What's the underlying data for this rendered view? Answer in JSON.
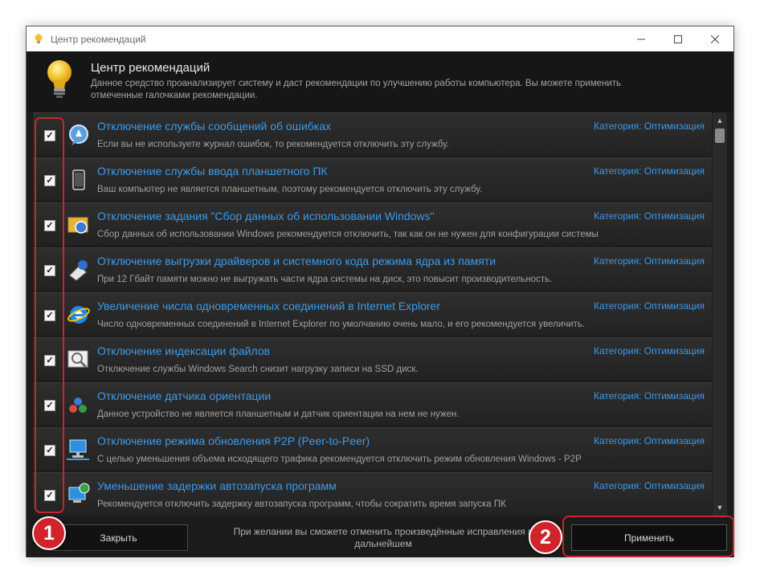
{
  "window": {
    "title": "Центр рекомендаций",
    "controls": [
      "minimize-icon",
      "maximize-icon",
      "close-icon"
    ]
  },
  "header": {
    "title": "Центр рекомендаций",
    "description": "Данное средство проанализирует систему и даст рекомендации по улучшению работы компьютера. Вы можете применить отмеченные галочками рекомендации."
  },
  "items": [
    {
      "title": "Отключение службы сообщений об ошибках",
      "category": "Категория: Оптимизация",
      "description": "Если вы не используете журнал ошибок, то рекомендуется отключить эту службу.",
      "checked": true,
      "icon": "error-report-icon"
    },
    {
      "title": "Отключение службы ввода планшетного ПК",
      "category": "Категория: Оптимизация",
      "description": "Ваш компьютер не является планшетным, поэтому рекомендуется отключить эту службу.",
      "checked": true,
      "icon": "tablet-icon"
    },
    {
      "title": "Отключение задания \"Сбор данных об использовании Windows\"",
      "category": "Категория: Оптимизация",
      "description": "Сбор данных об использовании Windows рекомендуется отключить, так как он не нужен для конфигурации системы",
      "checked": true,
      "icon": "data-collection-icon"
    },
    {
      "title": "Отключение выгрузки драйверов и системного кода режима ядра из памяти",
      "category": "Категория: Оптимизация",
      "description": "При 12 Гбайт памяти можно не выгружать части ядра системы на диск, это повысит производительность.",
      "checked": true,
      "icon": "memory-icon"
    },
    {
      "title": "Увеличение числа одновременных соединений в Internet Explorer",
      "category": "Категория: Оптимизация",
      "description": "Число одновременных соединений в Internet Explorer по умолчанию очень мало, и его рекомендуется увеличить.",
      "checked": true,
      "icon": "internet-explorer-icon"
    },
    {
      "title": "Отключение индексации файлов",
      "category": "Категория: Оптимизация",
      "description": "Отключение службы Windows Search снизит нагрузку записи на SSD диск.",
      "checked": true,
      "icon": "search-indexing-icon"
    },
    {
      "title": "Отключение датчика ориентации",
      "category": "Категория: Оптимизация",
      "description": "Данное устройство не является планшетным и датчик ориентации на нем не нужен.",
      "checked": true,
      "icon": "orientation-sensor-icon"
    },
    {
      "title": "Отключение режима обновления P2P (Peer-to-Peer)",
      "category": "Категория: Оптимизация",
      "description": "С целью уменьшения объема исходящего трафика рекомендуется отключить режим обновления Windows - P2P",
      "checked": true,
      "icon": "network-computer-icon"
    },
    {
      "title": "Уменьшение задержки автозапуска программ",
      "category": "Категория: Оптимизация",
      "description": "Рекомендуется отключить задержку автозапуска программ, чтобы сократить время запуска ПК",
      "checked": true,
      "icon": "autostart-icon"
    }
  ],
  "footer": {
    "close_label": "Закрыть",
    "note": "При желании вы сможете отменить произведённые исправления в дальнейшем",
    "apply_label": "Применить"
  },
  "annotations": {
    "badge1": "1",
    "badge2": "2",
    "highlight_color": "#c9252b"
  },
  "colors": {
    "link": "#3c9ae8",
    "background": "#1b1b1b"
  }
}
